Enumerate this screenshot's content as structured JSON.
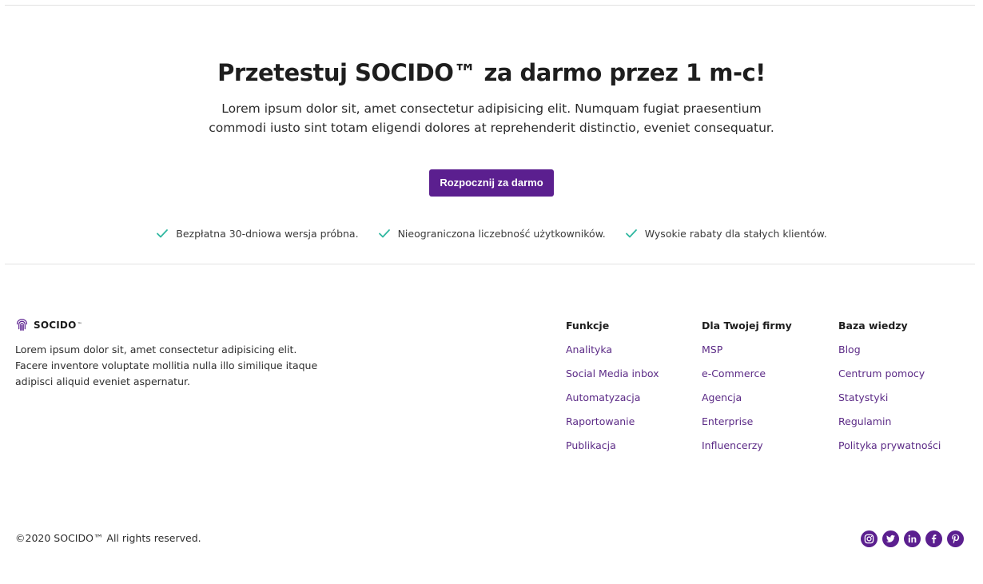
{
  "cta": {
    "title": "Przetestuj SOCIDO™ za darmo przez 1 m-c!",
    "description": "Lorem ipsum dolor sit, amet consectetur adipisicing elit. Numquam fugiat praesentium commodi iusto sint totam eligendi dolores at reprehenderit distinctio, eveniet consequatur.",
    "button_label": "Rozpocznij za darmo",
    "features": [
      "Bezpłatna 30-dniowa wersja próbna.",
      "Nieograniczona liczebność użytkowników.",
      "Wysokie rabaty dla stałych klientów."
    ],
    "check_icon": "check-icon",
    "check_color": "#2fb7a0"
  },
  "footer": {
    "brand": {
      "name": "SOCIDO",
      "tm": "™",
      "icon": "fingerprint-icon"
    },
    "about": "Lorem ipsum dolor sit, amet consectetur adipisicing elit. Facere inventore voluptate mollitia nulla illo similique itaque adipisci aliquid eveniet aspernatur.",
    "columns": [
      {
        "title": "Funkcje",
        "links": [
          "Analityka",
          "Social Media inbox",
          "Automatyzacja",
          "Raportowanie",
          "Publikacja"
        ]
      },
      {
        "title": "Dla Twojej firmy",
        "links": [
          "MSP",
          "e-Commerce",
          "Agencja",
          "Enterprise",
          "Influencerzy"
        ]
      },
      {
        "title": "Baza wiedzy",
        "links": [
          "Blog",
          "Centrum pomocy",
          "Statystyki",
          "Regulamin",
          "Polityka prywatności"
        ]
      }
    ],
    "copyright": "©2020 SOCIDO™ All rights reserved.",
    "socials": [
      "instagram-icon",
      "twitter-icon",
      "linkedin-icon",
      "facebook-icon",
      "pinterest-icon"
    ]
  },
  "colors": {
    "accent": "#5b1f8f",
    "link": "#5b2a86",
    "check": "#2fb7a0"
  }
}
